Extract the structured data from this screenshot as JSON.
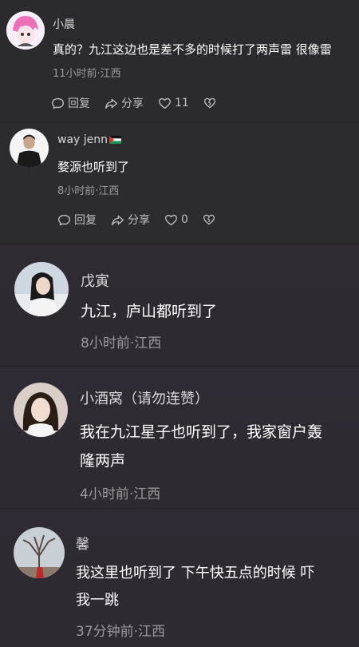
{
  "comments": [
    {
      "user": "小晨",
      "text": "真的？九江这边也是差不多的时候打了两声雷 很像雷",
      "meta": "11小时前·江西",
      "actions": {
        "reply": "回复",
        "share": "分享",
        "likes": "11"
      }
    },
    {
      "user": "way jenn",
      "text": "婺源也听到了",
      "meta": "8小时前·江西",
      "actions": {
        "reply": "回复",
        "share": "分享",
        "likes": "0"
      }
    },
    {
      "user": "戊寅",
      "text": "九江，庐山都听到了",
      "meta": "8小时前·江西"
    },
    {
      "user": "小酒窝（请勿连赞）",
      "text_line1": "我在九江星子也听到了，我家窗户轰",
      "text_line2": "隆两声",
      "meta": "4小时前·江西"
    },
    {
      "user": "馨",
      "text_line1": "我这里也听到了 下午快五点的时候 吓",
      "text_line2": "我一跳",
      "meta": "37分钟前·江西"
    }
  ],
  "icons": {
    "reply": "reply-bubble-icon",
    "share": "share-arrow-icon",
    "like": "heart-icon",
    "dislike": "broken-heart-icon",
    "flag": "palestine-flag-icon"
  }
}
